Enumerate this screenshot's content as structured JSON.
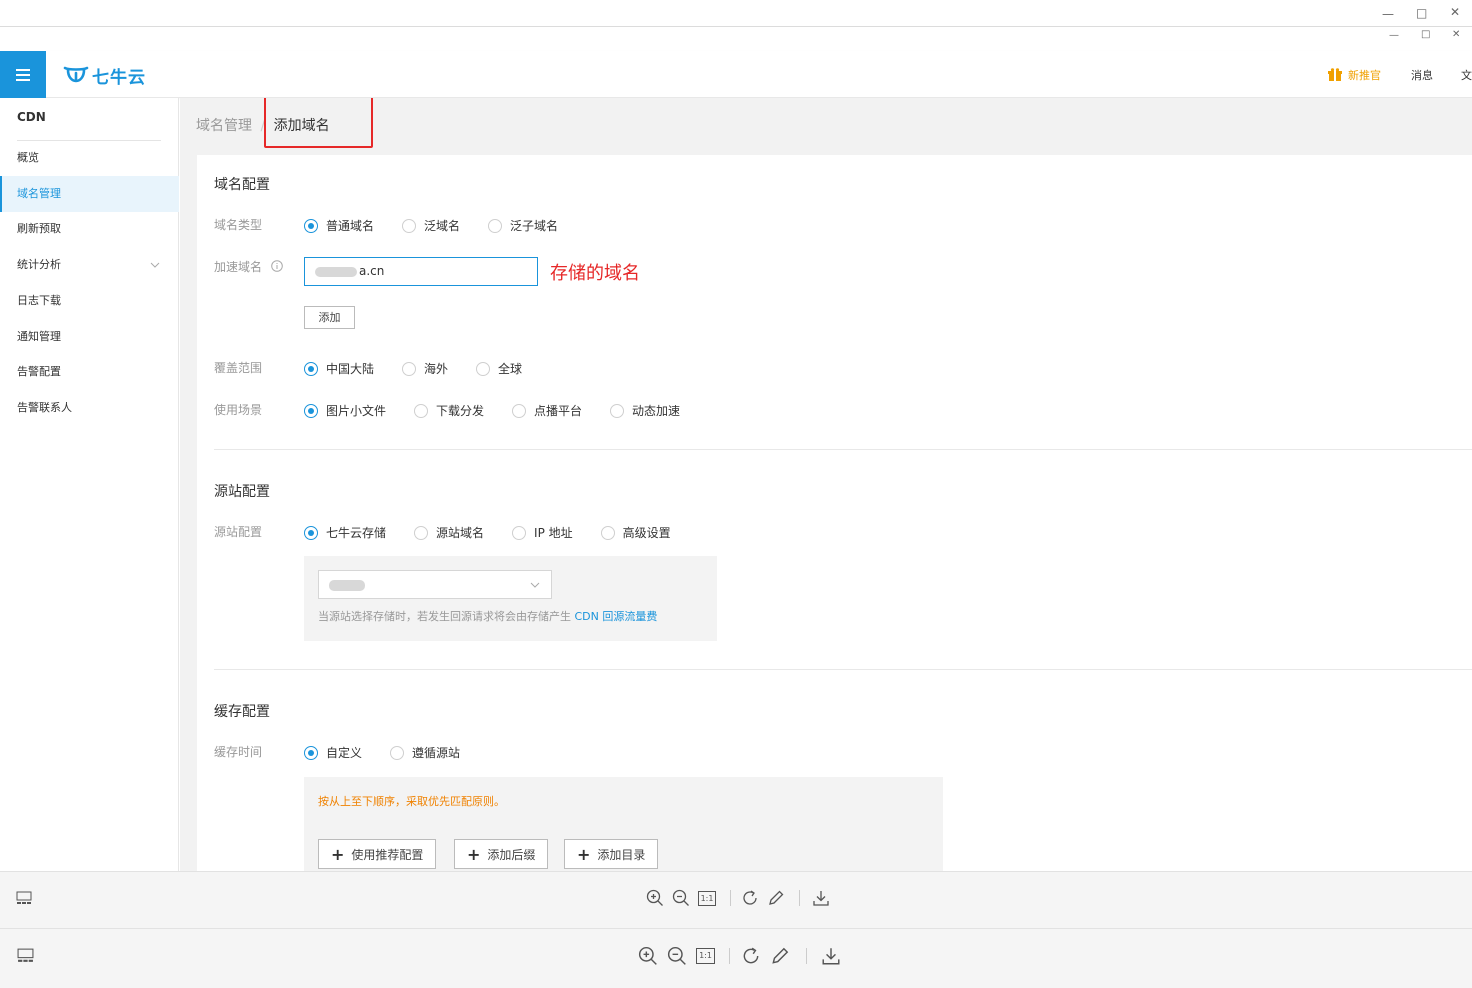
{
  "window": {
    "outer_controls": [
      "minimize-icon",
      "maximize-icon",
      "close-icon"
    ],
    "inner_controls": [
      "minimize-icon",
      "maximize-icon",
      "close-icon"
    ]
  },
  "header": {
    "logo_text": "七牛云",
    "links": [
      {
        "label": "新推官",
        "icon": "gift-icon",
        "color": "#f0a000"
      },
      {
        "label": "消息"
      },
      {
        "label": "文"
      }
    ]
  },
  "sidebar": {
    "title": "CDN",
    "items": [
      {
        "label": "概览"
      },
      {
        "label": "域名管理",
        "active": true
      },
      {
        "label": "刷新预取"
      },
      {
        "label": "统计分析",
        "has_chevron": true
      },
      {
        "label": "日志下载"
      },
      {
        "label": "通知管理"
      },
      {
        "label": "告警配置"
      },
      {
        "label": "告警联系人"
      }
    ]
  },
  "breadcrumb": {
    "parent": "域名管理",
    "separator": "/",
    "current": "添加域名"
  },
  "domain_config": {
    "title": "域名配置",
    "type_label": "域名类型",
    "type_options": [
      {
        "label": "普通域名",
        "checked": true
      },
      {
        "label": "泛域名"
      },
      {
        "label": "泛子域名"
      }
    ],
    "accel_label": "加速域名",
    "accel_value": "a.cn",
    "annotation": "存储的域名",
    "add_button": "添加",
    "coverage_label": "覆盖范围",
    "coverage_options": [
      {
        "label": "中国大陆",
        "checked": true
      },
      {
        "label": "海外"
      },
      {
        "label": "全球"
      }
    ],
    "scenario_label": "使用场景",
    "scenario_options": [
      {
        "label": "图片小文件",
        "checked": true
      },
      {
        "label": "下载分发"
      },
      {
        "label": "点播平台"
      },
      {
        "label": "动态加速"
      }
    ]
  },
  "origin_config": {
    "title": "源站配置",
    "label": "源站配置",
    "options": [
      {
        "label": "七牛云存储",
        "checked": true
      },
      {
        "label": "源站域名"
      },
      {
        "label": "IP 地址"
      },
      {
        "label": "高级设置"
      }
    ],
    "tip_prefix": "当源站选择存储时，若发生回源请求将会由存储产生",
    "tip_link": "CDN 回源流量费"
  },
  "cache_config": {
    "title": "缓存配置",
    "label": "缓存时间",
    "options": [
      {
        "label": "自定义",
        "checked": true
      },
      {
        "label": "遵循源站"
      }
    ],
    "tip": "按从上至下顺序，采取优先匹配原则。",
    "buttons": [
      "使用推荐配置",
      "添加后缀",
      "添加目录"
    ]
  },
  "viewer_toolbar": {
    "tools": [
      "zoom-in-icon",
      "zoom-out-icon",
      "actual-size-icon",
      "rotate-icon",
      "edit-icon",
      "download-icon"
    ],
    "actual_size_label": "1:1"
  },
  "colors": {
    "accent": "#1a94db",
    "annotation": "#e62828",
    "warning": "#f08200"
  }
}
